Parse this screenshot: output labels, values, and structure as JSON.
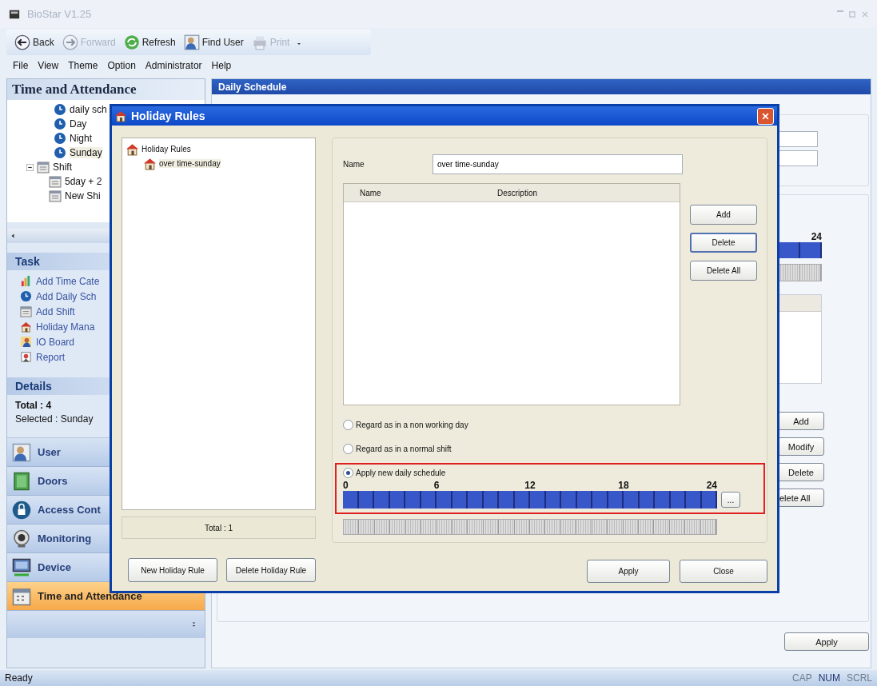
{
  "window": {
    "title": "BioStar V1.25",
    "active": false
  },
  "toolbar": [
    {
      "label": "Back",
      "kind": "back",
      "disabled": false
    },
    {
      "label": "Forward",
      "kind": "forward",
      "disabled": true
    },
    {
      "label": "Refresh",
      "kind": "refresh",
      "disabled": false
    },
    {
      "label": "Find User",
      "kind": "user",
      "disabled": false
    },
    {
      "label": "Print",
      "kind": "print",
      "disabled": true
    }
  ],
  "menu": [
    "File",
    "View",
    "Theme",
    "Option",
    "Administrator",
    "Help"
  ],
  "sidebar": {
    "title": "Time and Attendance",
    "tree": [
      {
        "label": "daily sch",
        "kind": "clock",
        "selected": false
      },
      {
        "label": "Day",
        "kind": "clock",
        "selected": false
      },
      {
        "label": "Night",
        "kind": "clock",
        "selected": false
      },
      {
        "label": "Sunday",
        "kind": "clock",
        "selected": true
      },
      {
        "label": "Shift",
        "kind": "shift",
        "selected": false,
        "expanded": true,
        "children": [
          {
            "label": "5day + 2",
            "kind": "shift",
            "selected": false
          },
          {
            "label": "New Shi",
            "kind": "shift",
            "selected": false
          }
        ]
      }
    ],
    "task": {
      "title": "Task",
      "items": [
        {
          "label": "Add Time Cate",
          "kind": "chart"
        },
        {
          "label": "Add Daily Sch",
          "kind": "clock"
        },
        {
          "label": "Add Shift",
          "kind": "shift"
        },
        {
          "label": "Holiday Mana",
          "kind": "house"
        },
        {
          "label": "IO Board",
          "kind": "person"
        },
        {
          "label": "Report",
          "kind": "report"
        }
      ]
    },
    "details": {
      "title": "Details",
      "total": "Total : 4",
      "selected_text": "Selected : Sunday"
    },
    "nav": [
      {
        "label": "User",
        "kind": "user",
        "selected": false
      },
      {
        "label": "Doors",
        "kind": "door",
        "selected": false
      },
      {
        "label": "Access Cont",
        "kind": "access",
        "selected": false
      },
      {
        "label": "Monitoring",
        "kind": "camera",
        "selected": false
      },
      {
        "label": "Device",
        "kind": "device",
        "selected": false
      },
      {
        "label": "Time and Attendance",
        "kind": "calendar",
        "selected": true
      }
    ]
  },
  "content": {
    "header": "Daily Schedule",
    "timeline_end": "24",
    "buttons": [
      "Add",
      "Modify",
      "Delete",
      "elete All"
    ],
    "apply": "Apply"
  },
  "dialog": {
    "title": "Holiday Rules",
    "tree": {
      "label": "Holiday Rules",
      "children": [
        {
          "label": "over time-sunday",
          "selected": true
        }
      ]
    },
    "total": "Total : 1",
    "name_label": "Name",
    "name_value": "over time-sunday",
    "table": {
      "columns": [
        "Name",
        "Description"
      ]
    },
    "side_buttons": [
      {
        "label": "Add",
        "focused": false
      },
      {
        "label": "Delete",
        "focused": true
      },
      {
        "label": "Delete All",
        "focused": false
      }
    ],
    "options": [
      {
        "label": "Regard as in a non working day",
        "selected": false,
        "highlighted": false
      },
      {
        "label": "Regard as in a normal shift",
        "selected": false,
        "highlighted": false
      },
      {
        "label": "Apply new daily schedule",
        "selected": true,
        "highlighted": true
      }
    ],
    "timeline": {
      "ticks": [
        "0",
        "6",
        "12",
        "18",
        "24"
      ],
      "more": "..."
    },
    "left_buttons": [
      "New Holiday Rule",
      "Delete Holiday Rule"
    ],
    "buttons": [
      "Apply",
      "Close"
    ]
  },
  "status_bar": {
    "text": "Ready",
    "indicators": [
      {
        "label": "CAP",
        "on": false
      },
      {
        "label": "NUM",
        "on": true
      },
      {
        "label": "SCRL",
        "on": false
      }
    ]
  }
}
